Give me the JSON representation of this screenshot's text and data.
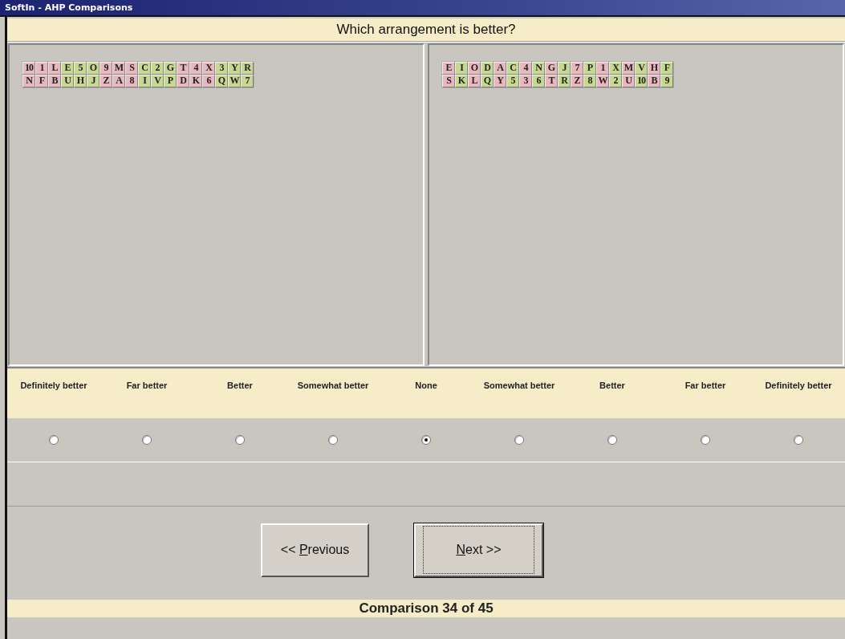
{
  "window": {
    "title": "SoftIn - AHP Comparisons"
  },
  "question": "Which arrangement is better?",
  "arrangements": [
    {
      "rows": [
        [
          {
            "label": "10",
            "color": "#e8b8bc"
          },
          {
            "label": "1",
            "color": "#e8b8bc"
          },
          {
            "label": "L",
            "color": "#e8b8bc"
          },
          {
            "label": "E",
            "color": "#c8d890"
          },
          {
            "label": "5",
            "color": "#c8d890"
          },
          {
            "label": "O",
            "color": "#c8d890"
          },
          {
            "label": "9",
            "color": "#e8b8bc"
          },
          {
            "label": "M",
            "color": "#e8b8bc"
          },
          {
            "label": "S",
            "color": "#e8b8bc"
          },
          {
            "label": "C",
            "color": "#c8d890"
          },
          {
            "label": "2",
            "color": "#c8d890"
          },
          {
            "label": "G",
            "color": "#c8d890"
          },
          {
            "label": "T",
            "color": "#e8b8bc"
          },
          {
            "label": "4",
            "color": "#e8b8bc"
          },
          {
            "label": "X",
            "color": "#e8b8bc"
          },
          {
            "label": "3",
            "color": "#c8d890"
          },
          {
            "label": "Y",
            "color": "#c8d890"
          },
          {
            "label": "R",
            "color": "#c8d890"
          }
        ],
        [
          {
            "label": "N",
            "color": "#e8b8bc"
          },
          {
            "label": "F",
            "color": "#e8b8bc"
          },
          {
            "label": "B",
            "color": "#e8b8bc"
          },
          {
            "label": "U",
            "color": "#c8d890"
          },
          {
            "label": "H",
            "color": "#c8d890"
          },
          {
            "label": "J",
            "color": "#c8d890"
          },
          {
            "label": "Z",
            "color": "#e8b8bc"
          },
          {
            "label": "A",
            "color": "#e8b8bc"
          },
          {
            "label": "8",
            "color": "#e8b8bc"
          },
          {
            "label": "I",
            "color": "#c8d890"
          },
          {
            "label": "V",
            "color": "#c8d890"
          },
          {
            "label": "P",
            "color": "#c8d890"
          },
          {
            "label": "D",
            "color": "#e8b8bc"
          },
          {
            "label": "K",
            "color": "#e8b8bc"
          },
          {
            "label": "6",
            "color": "#e8b8bc"
          },
          {
            "label": "Q",
            "color": "#c8d890"
          },
          {
            "label": "W",
            "color": "#c8d890"
          },
          {
            "label": "7",
            "color": "#c8d890"
          }
        ]
      ]
    },
    {
      "rows": [
        [
          {
            "label": "E",
            "color": "#e8b8bc"
          },
          {
            "label": "I",
            "color": "#c8d890"
          },
          {
            "label": "O",
            "color": "#e8b8bc"
          },
          {
            "label": "D",
            "color": "#c8d890"
          },
          {
            "label": "A",
            "color": "#e8b8bc"
          },
          {
            "label": "C",
            "color": "#c8d890"
          },
          {
            "label": "4",
            "color": "#e8b8bc"
          },
          {
            "label": "N",
            "color": "#c8d890"
          },
          {
            "label": "G",
            "color": "#e8b8bc"
          },
          {
            "label": "J",
            "color": "#c8d890"
          },
          {
            "label": "7",
            "color": "#e8b8bc"
          },
          {
            "label": "P",
            "color": "#c8d890"
          },
          {
            "label": "1",
            "color": "#e8b8bc"
          },
          {
            "label": "X",
            "color": "#c8d890"
          },
          {
            "label": "M",
            "color": "#e8b8bc"
          },
          {
            "label": "V",
            "color": "#c8d890"
          },
          {
            "label": "H",
            "color": "#e8b8bc"
          },
          {
            "label": "F",
            "color": "#c8d890"
          }
        ],
        [
          {
            "label": "S",
            "color": "#e8b8bc"
          },
          {
            "label": "K",
            "color": "#c8d890"
          },
          {
            "label": "L",
            "color": "#e8b8bc"
          },
          {
            "label": "Q",
            "color": "#c8d890"
          },
          {
            "label": "Y",
            "color": "#e8b8bc"
          },
          {
            "label": "5",
            "color": "#c8d890"
          },
          {
            "label": "3",
            "color": "#e8b8bc"
          },
          {
            "label": "6",
            "color": "#c8d890"
          },
          {
            "label": "T",
            "color": "#e8b8bc"
          },
          {
            "label": "R",
            "color": "#c8d890"
          },
          {
            "label": "Z",
            "color": "#e8b8bc"
          },
          {
            "label": "8",
            "color": "#c8d890"
          },
          {
            "label": "W",
            "color": "#e8b8bc"
          },
          {
            "label": "2",
            "color": "#c8d890"
          },
          {
            "label": "U",
            "color": "#e8b8bc"
          },
          {
            "label": "10",
            "color": "#c8d890"
          },
          {
            "label": "B",
            "color": "#e8b8bc"
          },
          {
            "label": "9",
            "color": "#c8d890"
          }
        ]
      ]
    }
  ],
  "scale": [
    {
      "label": "Definitely better",
      "selected": false
    },
    {
      "label": "Far better",
      "selected": false
    },
    {
      "label": "Better",
      "selected": false
    },
    {
      "label": "Somewhat better",
      "selected": false
    },
    {
      "label": "None",
      "selected": true
    },
    {
      "label": "Somewhat better",
      "selected": false
    },
    {
      "label": "Better",
      "selected": false
    },
    {
      "label": "Far better",
      "selected": false
    },
    {
      "label": "Definitely better",
      "selected": false
    }
  ],
  "buttons": [
    {
      "before": "<< ",
      "access_key": "P",
      "after": "revious",
      "focused": false
    },
    {
      "access_key": "N",
      "after": "ext >>",
      "focused": true
    }
  ],
  "status": "Comparison 34 of 45"
}
